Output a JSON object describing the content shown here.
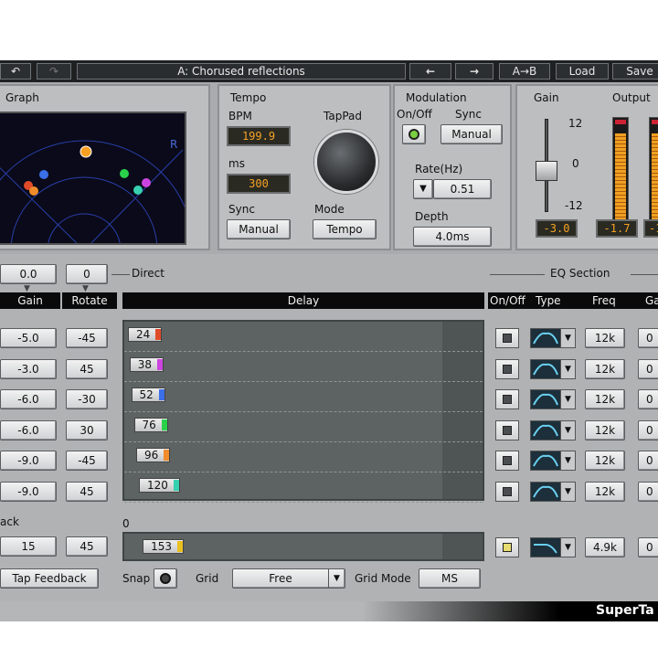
{
  "toolbar": {
    "undo_icon": "undo-icon",
    "redo_icon": "redo-icon",
    "preset_name": "A: Chorused reflections",
    "prev_label": "←",
    "next_label": "→",
    "ab_label": "A→B",
    "load_label": "Load",
    "save_label": "Save"
  },
  "graph": {
    "title": "Graph",
    "r_label": "R",
    "points": [
      {
        "color": "#f7a024"
      },
      {
        "color": "#3b6fe8"
      },
      {
        "color": "#e04b2a"
      },
      {
        "color": "#f08c2a"
      },
      {
        "color": "#2ad24a"
      },
      {
        "color": "#cc44e0"
      },
      {
        "color": "#36d0b0"
      }
    ]
  },
  "tempo": {
    "title": "Tempo",
    "bpm_label": "BPM",
    "bpm_value": "199.9",
    "ms_label": "ms",
    "ms_value": "300",
    "tappad_label": "TapPad",
    "sync_label": "Sync",
    "sync_value": "Manual",
    "mode_label": "Mode",
    "mode_value": "Tempo"
  },
  "modulation": {
    "title": "Modulation",
    "onoff_label": "On/Off",
    "sync_label": "Sync",
    "sync_value": "Manual",
    "rate_label": "Rate(Hz)",
    "rate_value": "0.51",
    "depth_label": "Depth",
    "depth_value": "4.0ms"
  },
  "gain_section": {
    "title": "Gain",
    "scale_top": "12",
    "scale_mid": "0",
    "scale_bottom": "-12",
    "value": "-3.0",
    "fader_level_db": -3.0
  },
  "output": {
    "title": "Output",
    "left_value": "-1.7",
    "right_value": "-1",
    "left_level": 0.9,
    "right_level": 0.9
  },
  "direct": {
    "gain": "0.0",
    "rotate": "0",
    "label": "Direct"
  },
  "columns": {
    "gain": "Gain",
    "rotate": "Rotate",
    "delay": "Delay",
    "eq_section": "EQ Section",
    "onoff": "On/Off",
    "type": "Type",
    "freq": "Freq",
    "gain_cut": "Ga"
  },
  "taps": [
    {
      "gain": "-5.0",
      "rotate": "-45",
      "delay": "24",
      "color": "#e04b2a",
      "freq": "12k",
      "eq_gain": "0"
    },
    {
      "gain": "-3.0",
      "rotate": "45",
      "delay": "38",
      "color": "#cc44e0",
      "freq": "12k",
      "eq_gain": "0"
    },
    {
      "gain": "-6.0",
      "rotate": "-30",
      "delay": "52",
      "color": "#3b6fe8",
      "freq": "12k",
      "eq_gain": "0"
    },
    {
      "gain": "-6.0",
      "rotate": "30",
      "delay": "76",
      "color": "#2ad24a",
      "freq": "12k",
      "eq_gain": "0"
    },
    {
      "gain": "-9.0",
      "rotate": "-45",
      "delay": "96",
      "color": "#f08c2a",
      "freq": "12k",
      "eq_gain": "0"
    },
    {
      "gain": "-9.0",
      "rotate": "45",
      "delay": "120",
      "color": "#36d0b0",
      "freq": "12k",
      "eq_gain": "0"
    }
  ],
  "feedback": {
    "label": "ack",
    "gain": "15",
    "rotate": "45",
    "zero_label": "0",
    "delay": "153",
    "color": "#e8c020",
    "freq": "4.9k",
    "eq_gain": "0",
    "tap_feedback_label": "Tap Feedback"
  },
  "controls": {
    "snap_label": "Snap",
    "grid_label": "Grid",
    "grid_value": "Free",
    "gridmode_label": "Grid Mode",
    "gridmode_value": "MS"
  },
  "brand": "SuperTa"
}
